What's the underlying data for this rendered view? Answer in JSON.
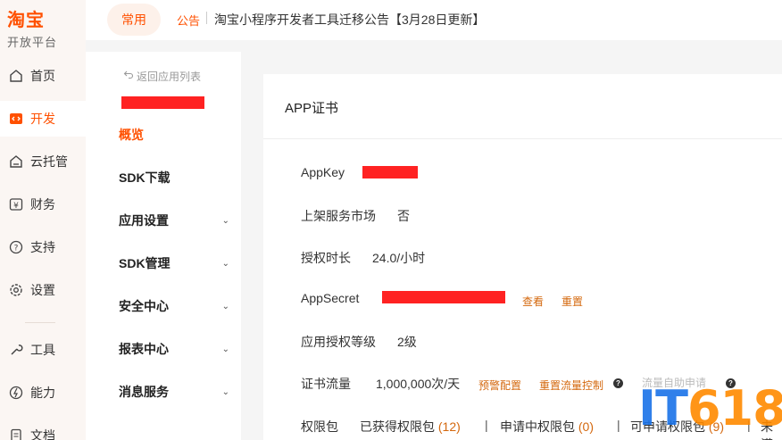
{
  "brand": {
    "title": "淘宝",
    "subtitle": "开放平台"
  },
  "rail": {
    "items": [
      {
        "label": "首页",
        "icon": "home-icon"
      },
      {
        "label": "开发",
        "icon": "code-icon",
        "active": true
      },
      {
        "label": "云托管",
        "icon": "cloud-icon"
      },
      {
        "label": "财务",
        "icon": "yen-icon"
      },
      {
        "label": "支持",
        "icon": "help-icon"
      },
      {
        "label": "设置",
        "icon": "gear-icon"
      },
      {
        "label": "工具",
        "icon": "wrench-icon"
      },
      {
        "label": "能力",
        "icon": "ability-icon"
      },
      {
        "label": "文档",
        "icon": "document-icon"
      }
    ]
  },
  "header": {
    "tab_common": "常用",
    "notice_tag": "公告",
    "notice_text": "淘宝小程序开发者工具迁移公告【3月28日更新】"
  },
  "subnav": {
    "back": "返回应用列表",
    "items": [
      {
        "label": "概览",
        "active": true
      },
      {
        "label": "SDK下载"
      },
      {
        "label": "应用设置",
        "expandable": true
      },
      {
        "label": "SDK管理",
        "expandable": true
      },
      {
        "label": "安全中心",
        "expandable": true
      },
      {
        "label": "报表中心",
        "expandable": true
      },
      {
        "label": "消息服务",
        "expandable": true
      }
    ]
  },
  "cert": {
    "title": "APP证书",
    "appkey_label": "AppKey",
    "market_label": "上架服务市场",
    "market_value": "否",
    "duration_label": "授权时长",
    "duration_value": "24.0/小时",
    "secret_label": "AppSecret",
    "secret_view": "查看",
    "secret_reset": "重置",
    "level_label": "应用授权等级",
    "level_value": "2级",
    "flow_label": "证书流量",
    "flow_value": "1,000,000次/天",
    "flow_alert": "预警配置",
    "flow_reset": "重置流量控制",
    "flow_self": "流量自助申请",
    "perm_label": "权限包",
    "perm_obtained": "已获得权限包",
    "perm_obtained_count": "(12)",
    "perm_applying": "申请中权限包",
    "perm_applying_count": "(0)",
    "perm_available": "可申请权限包",
    "perm_available_count": "(9)",
    "perm_more": "未满",
    "sep": "|"
  },
  "watermark": {
    "it": "IT",
    "num": "618"
  },
  "colors": {
    "accent": "#ff5000",
    "link": "#d4680e",
    "redact": "#f22"
  }
}
